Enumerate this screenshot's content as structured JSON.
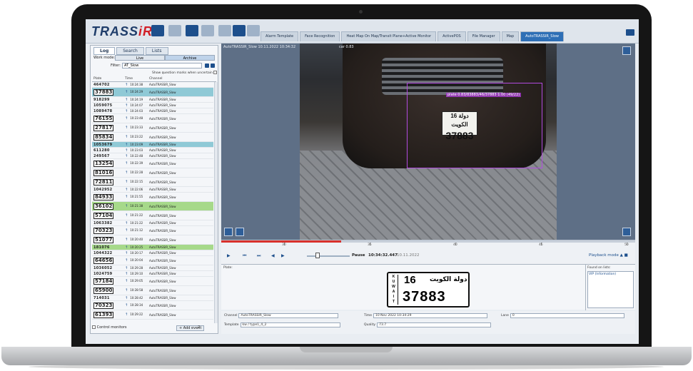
{
  "app": {
    "logo_main": "TRASS",
    "logo_accent": "iR",
    "tabs": [
      "Alarm Template",
      "Face Recognition",
      "Heat Map On Map/Transit Plane+Active Monitor",
      "ActivePOS",
      "File Manager",
      "Map",
      "AutoTRASSIR_Slow"
    ],
    "active_tab_index": 6,
    "accent_color": "#2e6fb6",
    "brand_red": "#d21f27"
  },
  "left_panel": {
    "tabs": [
      "Log",
      "Search",
      "Lists"
    ],
    "active_tab_index": 0,
    "work_mode_label": "Work mode:",
    "mode_live": "Live",
    "mode_archive": "Archive",
    "active_mode": "archive",
    "filter_label": "Filter:",
    "filter_value": "AT_Slow",
    "show_question_marks": "Show question marks when uncertain",
    "columns": [
      "Plate",
      "Time",
      "Channel"
    ],
    "rows": [
      {
        "plate": "464702",
        "boxed": false,
        "time": "10:24:38",
        "channel": "AutoTRASSIR_Slow",
        "hl": ""
      },
      {
        "plate": "37883",
        "boxed": true,
        "time": "10:24:29",
        "channel": "AutoTRASSIR_Slow",
        "hl": "blue"
      },
      {
        "plate": "918299",
        "boxed": false,
        "time": "10:24:19",
        "channel": "AutoTRASSIR_Slow",
        "hl": ""
      },
      {
        "plate": "1059075",
        "boxed": false,
        "time": "10:24:07",
        "channel": "AutoTRASSIR_Slow",
        "hl": ""
      },
      {
        "plate": "1089478",
        "boxed": false,
        "time": "10:24:03",
        "channel": "AutoTRASSIR_Slow",
        "hl": ""
      },
      {
        "plate": "76155",
        "boxed": true,
        "time": "10:23:48",
        "channel": "AutoTRASSIR_Slow",
        "hl": ""
      },
      {
        "plate": "27817",
        "boxed": true,
        "time": "10:23:33",
        "channel": "AutoTRASSIR_Slow",
        "hl": ""
      },
      {
        "plate": "85834",
        "boxed": true,
        "time": "10:23:22",
        "channel": "AutoTRASSIR_Slow",
        "hl": ""
      },
      {
        "plate": "1053679",
        "boxed": false,
        "time": "10:23:09",
        "channel": "AutoTRASSIR_Slow",
        "hl": "blue"
      },
      {
        "plate": "611280",
        "boxed": false,
        "time": "10:23:03",
        "channel": "AutoTRASSIR_Slow",
        "hl": ""
      },
      {
        "plate": "249567",
        "boxed": false,
        "time": "10:22:48",
        "channel": "AutoTRASSIR_Slow",
        "hl": ""
      },
      {
        "plate": "13254",
        "boxed": true,
        "time": "10:22:39",
        "channel": "AutoTRASSIR_Slow",
        "hl": ""
      },
      {
        "plate": "81016",
        "boxed": true,
        "time": "10:22:28",
        "channel": "AutoTRASSIR_Slow",
        "hl": ""
      },
      {
        "plate": "72811",
        "boxed": true,
        "time": "10:22:15",
        "channel": "AutoTRASSIR_Slow",
        "hl": ""
      },
      {
        "plate": "1042952",
        "boxed": false,
        "time": "10:22:06",
        "channel": "AutoTRASSIR_Slow",
        "hl": ""
      },
      {
        "plate": "84933",
        "boxed": true,
        "time": "10:21:55",
        "channel": "AutoTRASSIR_Slow",
        "hl": ""
      },
      {
        "plate": "36102",
        "boxed": true,
        "time": "10:21:38",
        "channel": "AutoTRASSIR_Slow",
        "hl": "green"
      },
      {
        "plate": "57104",
        "boxed": true,
        "time": "10:21:22",
        "channel": "AutoTRASSIR_Slow",
        "hl": ""
      },
      {
        "plate": "1063382",
        "boxed": false,
        "time": "10:21:22",
        "channel": "AutoTRASSIR_Slow",
        "hl": ""
      },
      {
        "plate": "70323",
        "boxed": true,
        "time": "10:21:12",
        "channel": "AutoTRASSIR_Slow",
        "hl": ""
      },
      {
        "plate": "51077",
        "boxed": true,
        "time": "10:20:40",
        "channel": "AutoTRASSIR_Slow",
        "hl": ""
      },
      {
        "plate": "181076",
        "boxed": false,
        "time": "10:20:25",
        "channel": "AutoTRASSIR_Slow",
        "hl": "green"
      },
      {
        "plate": "1044322",
        "boxed": false,
        "time": "10:20:17",
        "channel": "AutoTRASSIR_Slow",
        "hl": ""
      },
      {
        "plate": "64656",
        "boxed": true,
        "time": "10:20:04",
        "channel": "AutoTRASSIR_Slow",
        "hl": ""
      },
      {
        "plate": "1036052",
        "boxed": false,
        "time": "10:29:28",
        "channel": "AutoTRASSIR_Slow",
        "hl": ""
      },
      {
        "plate": "1024759",
        "boxed": false,
        "time": "10:29:10",
        "channel": "AutoTRASSIR_Slow",
        "hl": ""
      },
      {
        "plate": "57184",
        "boxed": true,
        "time": "10:29:05",
        "channel": "AutoTRASSIR_Slow",
        "hl": ""
      },
      {
        "plate": "65900",
        "boxed": true,
        "time": "10:28:58",
        "channel": "AutoTRASSIR_Slow",
        "hl": ""
      },
      {
        "plate": "714031",
        "boxed": false,
        "time": "10:28:42",
        "channel": "AutoTRASSIR_Slow",
        "hl": ""
      },
      {
        "plate": "70323",
        "boxed": true,
        "time": "10:28:34",
        "channel": "AutoTRASSIR_Slow",
        "hl": ""
      },
      {
        "plate": "61393",
        "boxed": true,
        "time": "10:29:22",
        "channel": "AutoTRASSIR_Slow",
        "hl": ""
      }
    ],
    "control_monitors": "Control monitors",
    "add_event": "Add event",
    "event_count": "2"
  },
  "video": {
    "channel_overlay": "AutoTRASSIR_Slow 10.11.2022 10:34:32",
    "lpr_overlay": "car 0.83",
    "detection_label": "plate 0.83/83883/46/37883 1.00 (49/22)",
    "car_plate_top": "16 دولة الكويت",
    "car_plate_number": "37883"
  },
  "timeline": {
    "ticks": [
      "30",
      "35",
      "40",
      "45",
      "50"
    ],
    "state": "Pause",
    "current_time": "10:34:32.447",
    "current_date": "10.11.2022",
    "playback_mode": "Playback mode",
    "progress": 0.29
  },
  "plate_detail": {
    "label": "Plate:",
    "side_letters": [
      "K",
      "U",
      "W",
      "A",
      "I",
      "T"
    ],
    "top_number": "16",
    "top_arabic": "دولة الكويت",
    "number": "37883",
    "found_on_lists": "Found on lists:",
    "found_value": "VIP (Information)"
  },
  "info": {
    "channel_label": "Channel",
    "channel_value": "AutoTRASSIR_Slow",
    "time_label": "Time",
    "time_value": "10 Nov 2022 10:34:29",
    "lane_label": "Lane",
    "lane_value": "0",
    "template_label": "Template",
    "template_value": "kw / type1_4_2",
    "quality_label": "Quality",
    "quality_value": "73.7"
  }
}
